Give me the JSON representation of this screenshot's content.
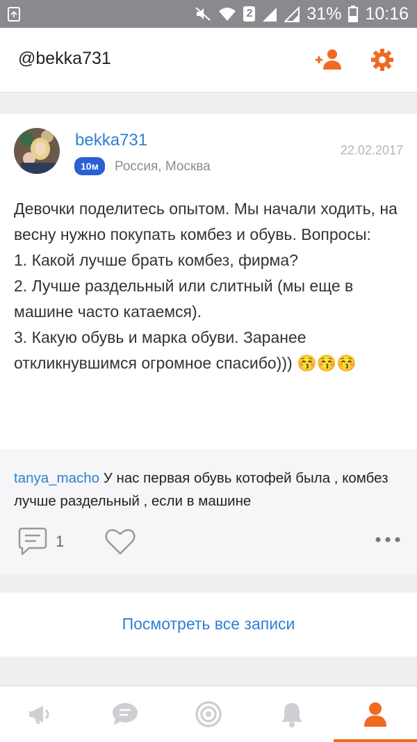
{
  "status_bar": {
    "battery": "31%",
    "time": "10:16",
    "sim": "2"
  },
  "top_bar": {
    "title": "@bekka731",
    "icons": [
      "add-friend-icon",
      "settings-icon"
    ]
  },
  "post": {
    "author": "bekka731",
    "badge": "10м",
    "location": "Россия, Москва",
    "date": "22.02.2017",
    "text": "Девочки поделитесь опытом. Мы начали ходить, на весну нужно покупать комбез и обувь. Вопросы:\n1. Какой лучше брать комбез, фирма?\n2. Лучше раздельный или слитный (мы еще в машине часто катаемся).\n3. Какую обувь и марка обуви. Заранее откликнувшимся огромное спасибо)))",
    "emoji": "😚😚😚"
  },
  "comment": {
    "author": "tanya_macho",
    "text": "У нас первая обувь котофей была , комбез лучше раздельный , если в машине"
  },
  "actions": {
    "comment_count": "1"
  },
  "view_all": "Посмотреть все записи",
  "bottom_nav": {
    "items": [
      "megaphone-icon",
      "chat-icon",
      "target-icon",
      "bell-icon",
      "profile-icon"
    ],
    "active_index": 4
  },
  "colors": {
    "accent": "#f06a22",
    "link": "#2d7fd3",
    "badge": "#2a5fd6"
  }
}
